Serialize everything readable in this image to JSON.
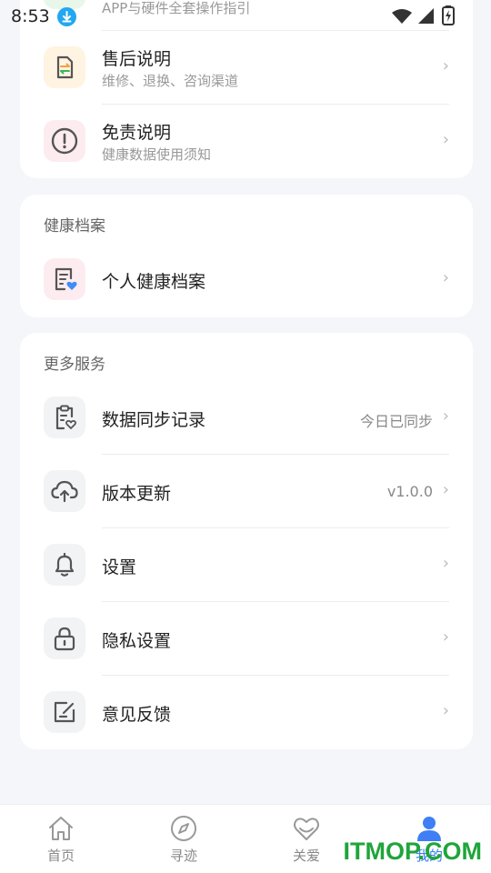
{
  "status_bar": {
    "time": "8:53"
  },
  "support_card": {
    "partial_subtitle": "APP与硬件全套操作指引",
    "items": [
      {
        "title": "售后说明",
        "subtitle": "维修、退换、咨询渠道",
        "icon": "exchange-doc-icon"
      },
      {
        "title": "免责说明",
        "subtitle": "健康数据使用须知",
        "icon": "exclamation-icon"
      }
    ]
  },
  "health_card": {
    "section_title": "健康档案",
    "items": [
      {
        "title": "个人健康档案",
        "icon": "health-record-icon"
      }
    ]
  },
  "services_card": {
    "section_title": "更多服务",
    "items": [
      {
        "title": "数据同步记录",
        "value": "今日已同步",
        "icon": "clipboard-heart-icon"
      },
      {
        "title": "版本更新",
        "value": "v1.0.0",
        "icon": "cloud-upload-icon"
      },
      {
        "title": "设置",
        "value": "",
        "icon": "bell-icon"
      },
      {
        "title": "隐私设置",
        "value": "",
        "icon": "lock-icon"
      },
      {
        "title": "意见反馈",
        "value": "",
        "icon": "feedback-edit-icon"
      }
    ]
  },
  "chevron": "›",
  "tabbar": {
    "tabs": [
      {
        "label": "首页",
        "icon": "home-icon"
      },
      {
        "label": "寻迹",
        "icon": "compass-icon"
      },
      {
        "label": "关爱",
        "icon": "heart-icon"
      },
      {
        "label": "我的",
        "icon": "user-icon",
        "active": true
      }
    ]
  },
  "watermark": "ITMOP.COM",
  "colors": {
    "accent": "#3f7ef5",
    "orange": "#f5a13a",
    "red": "#f06b6b",
    "pink_bg": "#fdecef",
    "orange_bg": "#fff3e2",
    "gray_bg": "#f2f3f5",
    "watermark": "#1fa53a"
  }
}
